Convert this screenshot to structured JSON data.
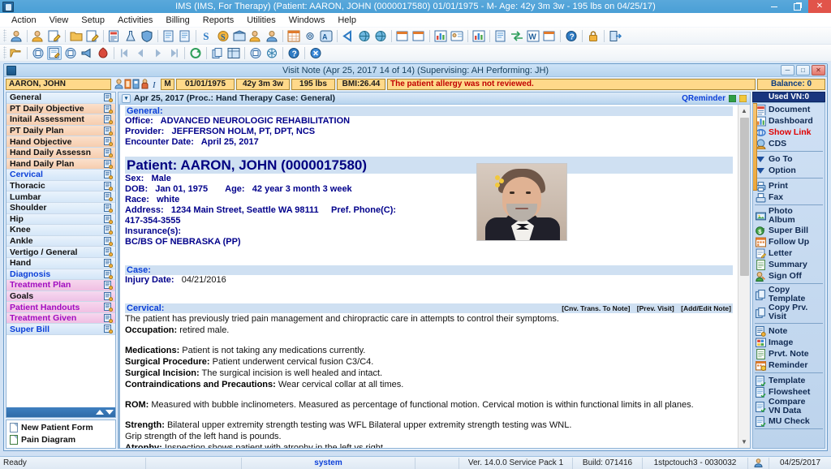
{
  "window": {
    "title": "IMS (IMS, For Therapy)    (Patient: AARON, JOHN  (0000017580) 01/01/1975 - M- Age: 42y 3m 3w - 195 lbs on 04/25/17)",
    "minimize_label": "–",
    "restore_label": "❐",
    "close_label": "✕"
  },
  "menu": {
    "items": [
      {
        "label": "Action"
      },
      {
        "label": "View"
      },
      {
        "label": "Setup"
      },
      {
        "label": "Activities"
      },
      {
        "label": "Billing"
      },
      {
        "label": "Reports"
      },
      {
        "label": "Utilities"
      },
      {
        "label": "Windows"
      },
      {
        "label": "Help"
      }
    ]
  },
  "mdi": {
    "title": "Visit Note (Apr 25, 2017   14 of 14) (Supervising: AH Performing: JH)",
    "min_label": "–",
    "restore_label": "❐",
    "close_label": "✕"
  },
  "patient_bar": {
    "name": "AARON, JOHN",
    "sex": "M",
    "dob": "01/01/1975",
    "age": "42y 3m 3w",
    "weight": "195 lbs",
    "bmi": "BMI:26.44",
    "alert": "The patient allergy was not reviewed.",
    "balance": "Balance: 0"
  },
  "visit_bar": {
    "text": "Apr 25, 2017  (Proc.: Hand Therapy  Case: General)",
    "qreminder": "QReminder"
  },
  "used_vn": "Used VN:0",
  "categories": [
    {
      "label": "General",
      "style": "g-blue"
    },
    {
      "label": "PT Daily Objective",
      "style": "g-peach"
    },
    {
      "label": "Initail Assessment",
      "style": "g-peach"
    },
    {
      "label": "PT Daily Plan",
      "style": "g-peach"
    },
    {
      "label": "Hand Objective",
      "style": "g-peach"
    },
    {
      "label": "Hand Daily Assessn",
      "style": "g-peach"
    },
    {
      "label": "Hand Daily Plan",
      "style": "g-peach"
    },
    {
      "label": "Cervical",
      "style": "g-cyan"
    },
    {
      "label": "Thoracic",
      "style": "g-blue"
    },
    {
      "label": "Lumbar",
      "style": "g-blue"
    },
    {
      "label": "Shoulder",
      "style": "g-blue"
    },
    {
      "label": "Hip",
      "style": "g-blue"
    },
    {
      "label": "Knee",
      "style": "g-blue"
    },
    {
      "label": "Ankle",
      "style": "g-blue"
    },
    {
      "label": "Vertigo / General",
      "style": "g-blue"
    },
    {
      "label": "Hand",
      "style": "g-blue"
    },
    {
      "label": "Diagnosis",
      "style": "g-cyan"
    },
    {
      "label": "Treatment Plan",
      "style": "g-pink"
    },
    {
      "label": "Goals",
      "style": "g-lav"
    },
    {
      "label": "Patient Handouts",
      "style": "g-pink"
    },
    {
      "label": "Treatment Given",
      "style": "g-pink"
    },
    {
      "label": "Super Bill",
      "style": "g-sb"
    }
  ],
  "forms": [
    {
      "label": "New Patient Form",
      "icon": "document-icon"
    },
    {
      "label": "Pain Diagram",
      "icon": "document-green-icon"
    }
  ],
  "actions": [
    {
      "label": "Document",
      "icon": "document-icon",
      "divider_after": false
    },
    {
      "label": "Dashboard",
      "icon": "dashboard-icon",
      "divider_after": false
    },
    {
      "label": "Show Link",
      "icon": "link-icon",
      "red": true,
      "divider_after": false
    },
    {
      "label": "CDS",
      "icon": "cds-icon",
      "divider_after": true
    },
    {
      "label": "Go To",
      "icon": "triangle-down-icon",
      "divider_after": false
    },
    {
      "label": "Option",
      "icon": "triangle-down-icon",
      "divider_after": true
    },
    {
      "label": "Print",
      "icon": "print-icon",
      "divider_after": false
    },
    {
      "label": "Fax",
      "icon": "fax-icon",
      "divider_after": true
    },
    {
      "label": "Photo",
      "label2": "Album",
      "icon": "photo-album-icon",
      "divider_after": false
    },
    {
      "label": "Super Bill",
      "icon": "super-bill-icon",
      "divider_after": false
    },
    {
      "label": "Follow Up",
      "icon": "follow-up-icon",
      "divider_after": false
    },
    {
      "label": "Letter",
      "icon": "letter-icon",
      "divider_after": false
    },
    {
      "label": "Summary",
      "icon": "summary-icon",
      "divider_after": false
    },
    {
      "label": "Sign Off",
      "icon": "sign-off-icon",
      "divider_after": true
    },
    {
      "label": "Copy",
      "label2": "Template",
      "icon": "copy-template-icon",
      "divider_after": false
    },
    {
      "label": "Copy Prv.",
      "label2": "Visit",
      "icon": "copy-prev-visit-icon",
      "divider_after": true
    },
    {
      "label": "Note",
      "icon": "note-icon",
      "divider_after": false
    },
    {
      "label": "Image",
      "icon": "image-icon",
      "divider_after": false
    },
    {
      "label": "Prvt. Note",
      "icon": "private-note-icon",
      "divider_after": false
    },
    {
      "label": "Reminder",
      "icon": "reminder-icon",
      "divider_after": true
    },
    {
      "label": "Template",
      "icon": "template-icon",
      "divider_after": false
    },
    {
      "label": "Flowsheet",
      "icon": "flowsheet-icon",
      "divider_after": false
    },
    {
      "label": "Compare",
      "label2": "VN Data",
      "icon": "compare-vn-icon",
      "divider_after": false
    },
    {
      "label": "MU Check",
      "icon": "mu-check-icon",
      "divider_after": true
    }
  ],
  "note": {
    "general_heading": "General:",
    "office_label": "Office:",
    "office_value": "ADVANCED NEUROLOGIC REHABILITATION",
    "provider_label": "Provider:",
    "provider_value": "JEFFERSON HOLM, PT, DPT, NCS",
    "encounter_label": "Encounter Date:",
    "encounter_value": "April 25, 2017",
    "patient_heading": "Patient: AARON, JOHN   (0000017580)",
    "sex_label": "Sex:",
    "sex_value": "Male",
    "dob_label": "DOB:",
    "dob_value": "Jan 01, 1975",
    "age_label": "Age:",
    "age_value": "42 year 3 month 3 week",
    "race_label": "Race:",
    "race_value": "white",
    "address_label": "Address:",
    "address_value": "1234 Main Street,  Seattle  WA  98111",
    "phone_label": "Pref. Phone(C):",
    "phone_value": "417-354-3555",
    "insurance_label": "Insurance(s):",
    "insurance_value": "BC/BS OF NEBRASKA (PP)",
    "case_heading": "Case:",
    "injury_label": "Injury Date:",
    "injury_value": "04/21/2016",
    "cervical_heading": "Cervical:",
    "cervical_actions": [
      "[Cnv. Trans. To Note]",
      "[Prev. Visit]",
      "[Add/Edit Note]"
    ],
    "body_lines": [
      {
        "text": "The patient has previously tried pain management and chiropractic care in attempts to control their symptoms."
      },
      {
        "bold": "Occupation:",
        "text": " retired male."
      },
      {
        "gap": true
      },
      {
        "bold": "Medications:",
        "text": " Patient is not taking any medications currently."
      },
      {
        "bold": "Surgical Procedure:",
        "text": " Patient underwent cervical fusion C3/C4."
      },
      {
        "bold": "Surgical Incision:",
        "text": " The surgical incision is well healed and intact."
      },
      {
        "bold": "Contraindications and Precautions:",
        "text": " Wear cervical collar at all times."
      },
      {
        "gap": true
      },
      {
        "bold": "ROM:",
        "text": " Measured with bubble inclinometers. Measured as percentage of functional motion. Cervical motion is within functional limits in all planes."
      },
      {
        "gap": true
      },
      {
        "bold": "Strength:",
        "text": " Bilateral upper extremity strength testing was WFL Bilateral upper extremity strength testing was WNL."
      },
      {
        "text": "Grip strength of the left hand is pounds."
      },
      {
        "bold": "Atrophy:",
        "text": " Inspection shows patient with atrophy in the left vs right."
      }
    ]
  },
  "status_bar": {
    "ready": "Ready",
    "system": "system",
    "version": "Ver. 14.0.0 Service Pack 1",
    "build": "Build: 071416",
    "machine": "1stpctouch3 - 0030032",
    "date": "04/25/2017"
  },
  "colors": {
    "title_blue": "#4a9fd6",
    "close_red": "#e1544a",
    "accent_dark_blue": "#19367e",
    "field_amber": "#ffd98a",
    "alert_red": "#c00000",
    "link_blue": "#0b3fd8",
    "section_band": "#cfe0f2"
  }
}
